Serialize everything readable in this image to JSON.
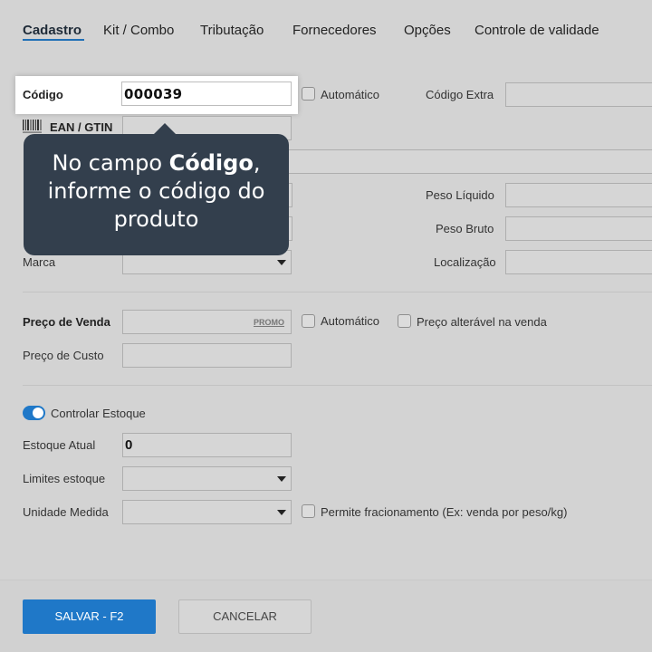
{
  "tabs": [
    {
      "label": "Cadastro",
      "active": true
    },
    {
      "label": "Kit / Combo"
    },
    {
      "label": "Tributação"
    },
    {
      "label": "Fornecedores"
    },
    {
      "label": "Opções"
    },
    {
      "label": "Controle de validade"
    }
  ],
  "form": {
    "codigo_label": "Código",
    "codigo_value": "000039",
    "automatico_label": "Automático",
    "codigo_extra_label": "Código Extra",
    "ean_label": "EAN / GTIN",
    "peso_liquido_label": "Peso Líquido",
    "peso_bruto_label": "Peso Bruto",
    "marca_label": "Marca",
    "localizacao_label": "Localização",
    "preco_venda_label": "Preço de Venda",
    "promo_label": "PROMO",
    "preco_automatico_label": "Automático",
    "preco_alteravel_label": "Preço alterável na venda",
    "preco_custo_label": "Preço de Custo",
    "controlar_estoque_label": "Controlar Estoque",
    "controlar_estoque_on": true,
    "estoque_atual_label": "Estoque Atual",
    "estoque_atual_value": "0",
    "limites_estoque_label": "Limites estoque",
    "unidade_medida_label": "Unidade Medida",
    "fracionamento_label": "Permite fracionamento (Ex: venda por peso/kg)"
  },
  "tooltip": {
    "line1_prefix": "No campo ",
    "line1_bold": "Código",
    "line1_suffix": ",",
    "line2": "informe o código do",
    "line3": "produto"
  },
  "footer": {
    "save_label": "SALVAR - F2",
    "cancel_label": "CANCELAR"
  },
  "colors": {
    "accent": "#1f78c8",
    "tooltip_bg": "#333f4d",
    "overlay_bg": "#d3d3d3"
  }
}
